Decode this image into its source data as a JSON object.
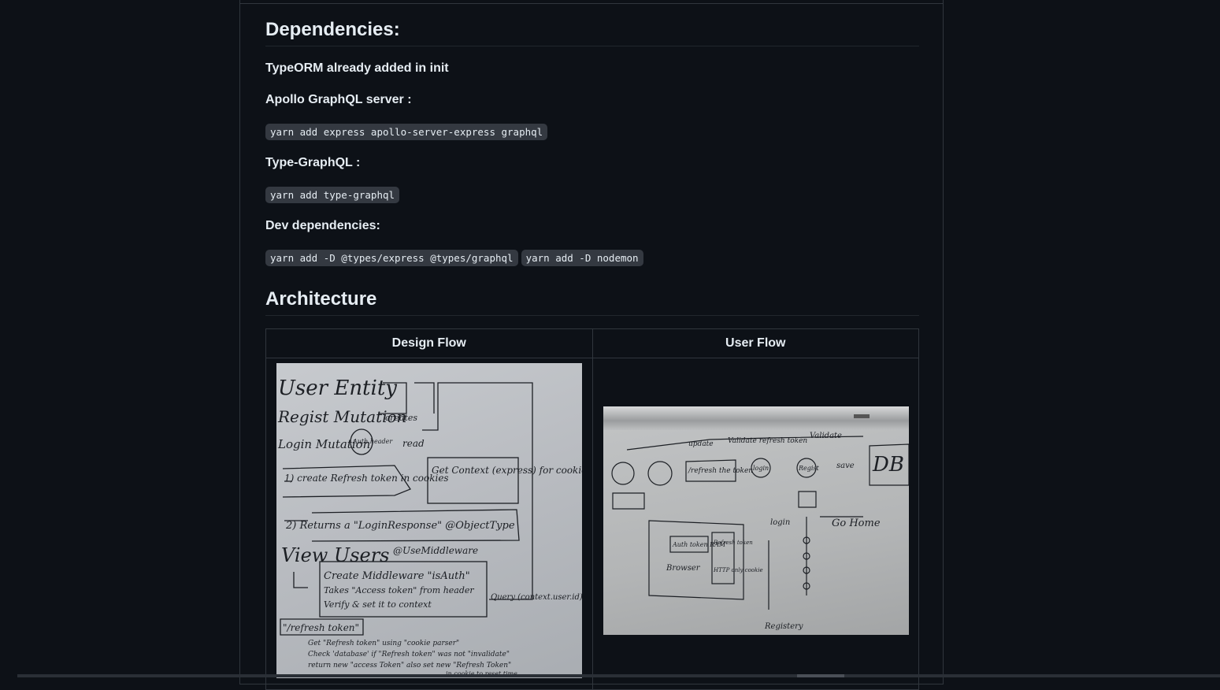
{
  "headings": {
    "dependencies": "Dependencies:",
    "architecture": "Architecture"
  },
  "paragraphs": {
    "typeorm": "TypeORM already added in init",
    "apollo": "Apollo GraphQL server :",
    "typegraphql": "Type-GraphQL :",
    "dev": "Dev dependencies:"
  },
  "code": {
    "apollo_cmd": "yarn add express apollo-server-express graphql",
    "typegraphql_cmd": "yarn add type-graphql",
    "dev_cmd_1": "yarn add -D @types/express @types/graphql",
    "dev_cmd_2": "yarn add -D nodemon"
  },
  "table": {
    "headers": [
      "Design Flow",
      "User Flow"
    ]
  },
  "images": {
    "design_flow": {
      "lines": [
        "User Entity",
        "Regist Mutation",
        "creates",
        "Login Mutation",
        "Auth header",
        "read",
        "1) create Refresh token in cookies",
        "Get Context (express) for cookie setting",
        "2) Returns a \"LoginResponse\" @ObjectType",
        "View Users",
        "@UseMiddleware",
        "Create Middleware \"isAuth\"",
        "Takes \"Access token\" from header",
        "Verify & set it to context",
        "Query (context.user.id)",
        "\"/refresh token\"",
        "Get \"Refresh token\" using \"cookie parser\"",
        "Check 'database' if \"Refresh token\" was not \"invalidate\"",
        "return new \"access Token\" also set new \"Refresh Token\"",
        "in cookie to reset time"
      ]
    },
    "user_flow": {
      "lines": [
        "Validate",
        "Validate refresh token",
        "update",
        "DB",
        "/refresh the token",
        "login",
        "Regist",
        "save",
        "Go Home",
        "login",
        "Registery",
        "Auth token RAM",
        "Refresh token",
        "HTTP only cookie",
        "Browser"
      ]
    }
  }
}
